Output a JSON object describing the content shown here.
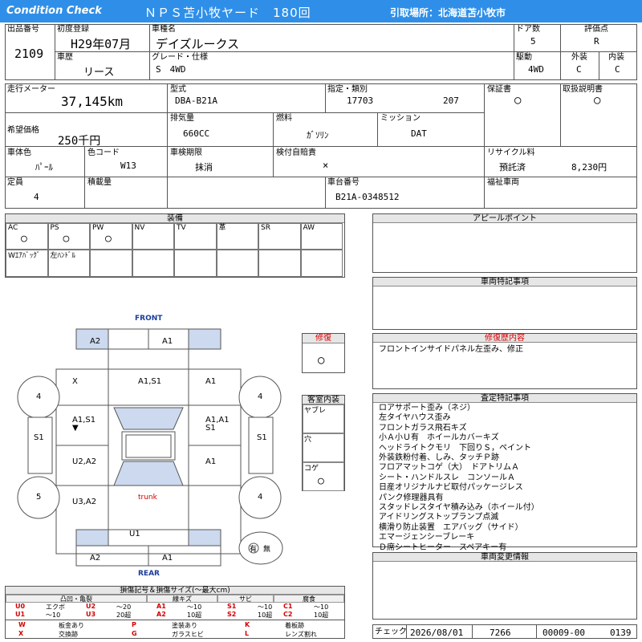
{
  "header": {
    "title_left": "Condition  Check",
    "title_center": "ＮＰＳ苫小牧ヤード　180回",
    "pickup": "引取場所：北海道苫小牧市"
  },
  "info": {
    "lot_label": "出品番号",
    "lot": "2109",
    "first_reg_label": "初度登録",
    "first_reg": "H29年07月",
    "car_name_label": "車種名",
    "car_name": "デイズルークス",
    "doors_label": "ドア数",
    "doors": "5",
    "grade_label": "評価点",
    "grade": "R",
    "history_label": "車歴",
    "history": "リース",
    "trim_label": "グレード・仕様",
    "trim": "S　4WD",
    "drive_label": "駆動",
    "drive": "4WD",
    "exterior_label": "外装",
    "exterior": "C",
    "interior_label": "内装",
    "interior": "C",
    "mileage_label": "走行メーター",
    "mileage": "37,145km",
    "model_label": "型式",
    "model": "DBA-B21A",
    "designation_label": "指定・類別",
    "designation": "17703",
    "classification": "207",
    "warranty_label": "保証書",
    "warranty": "○",
    "manual_label": "取扱説明書",
    "manual": "○",
    "desired_price_label": "希望価格",
    "desired_price": "250千円",
    "displacement_label": "排気量",
    "displacement": "660CC",
    "fuel_label": "燃料",
    "fuel": "ｶﾞｿﾘﾝ",
    "mission_label": "ミッション",
    "mission": "DAT",
    "color_label": "車体色",
    "color": "ﾊﾟｰﾙ",
    "color_code_label": "色コード",
    "color_code": "W13",
    "inspection_label": "車検期限",
    "inspection": "抹消",
    "insurance_label": "検付自賠責",
    "insurance": "×",
    "recycle_label": "リサイクル料",
    "recycle_status": "預託済",
    "recycle_amount": "8,230円",
    "capacity_label": "定員",
    "capacity": "4",
    "load_label": "積載量",
    "load": "",
    "chassis_label": "車台番号",
    "chassis": "B21A-0348512",
    "welfare_label": "福祉車両"
  },
  "equipment": {
    "title": "装備",
    "row1": [
      {
        "label": "AC",
        "mark": "○"
      },
      {
        "label": "PS",
        "mark": "○"
      },
      {
        "label": "PW",
        "mark": "○"
      },
      {
        "label": "NV",
        "mark": ""
      },
      {
        "label": "TV",
        "mark": ""
      },
      {
        "label": "革",
        "mark": ""
      },
      {
        "label": "SR",
        "mark": ""
      },
      {
        "label": "AW",
        "mark": ""
      }
    ],
    "row2": [
      {
        "label": "Wｴｱﾊﾞｯｸﾞ"
      },
      {
        "label": "左ﾊﾝﾄﾞﾙ"
      }
    ]
  },
  "panels": {
    "appeal_title": "アピールポイント",
    "special_title": "車両特記事項",
    "repair_title": "修復",
    "repair_mark": "○",
    "repair_detail_title": "修復歴内容",
    "repair_detail": "フロントインサイドパネル左歪み、修正",
    "cabin_title": "客室内装",
    "cabin_rows": [
      {
        "label": "ヤブレ",
        "mark": ""
      },
      {
        "label": "穴",
        "mark": ""
      },
      {
        "label": "コゲ",
        "mark": "○"
      }
    ],
    "inspection_title": "査定特記事項",
    "inspection_notes": [
      "ロアサポート歪み（ネジ）",
      "左タイヤハウス歪み",
      "フロントガラス飛石キズ",
      "小Ａ小Ｕ有　ホイールカバーキズ",
      "ヘッドライトクモリ　下回りＳ，ペイント",
      "外装鉄粉付着、しみ、タッチＰ跡",
      "フロアマットコゲ（大）　ドアトリムＡ",
      "シート・ハンドルスレ　コンソールＡ",
      "日産オリジナルナビ取付パッケージレス",
      "パンク修理器具有",
      "スタッドレスタイヤ積み込み（ホイール付）",
      "アイドリングストップランプ点滅",
      "横滑り防止装置　エアバッグ（サイド）",
      "エマージェンシーブレーキ",
      "Ｄ席シートヒーター　スペアキー有"
    ],
    "change_title": "車両変更情報"
  },
  "diagram": {
    "front": "FRONT",
    "rear": "REAR",
    "trunk": "trunk",
    "labels": {
      "top_left": "A2",
      "top_right": "A1",
      "x": "X",
      "hood": "A1,S1",
      "fr_fender": "A1",
      "fl_door": "A1,S1\n▼",
      "fr_door": "A1,A1\nS1",
      "rl_door": "U2,A2",
      "rr_door": "A1",
      "rl_quarter": "U3,A2",
      "rr_quarter": "4",
      "rear_bumper": "U1",
      "bottom_left": "A2",
      "bottom_right": "A1",
      "tire_fl": "4",
      "tire_fr": "4",
      "tire_rl": "5",
      "tire_rr": "4",
      "side_l": "S1",
      "side_r": "S1",
      "spare": "有",
      "spare_none": "無"
    }
  },
  "legend": {
    "title": "損傷記号＆損傷サイズ(〜最大cm)",
    "groups": [
      {
        "name": "凸凹・亀裂",
        "codes": [
          [
            "U0",
            "エクボ"
          ],
          [
            "U1",
            "〜10"
          ],
          [
            "U2",
            "〜20"
          ],
          [
            "U3",
            "20超"
          ]
        ]
      },
      {
        "name": "線キズ",
        "codes": [
          [
            "A1",
            "〜10"
          ],
          [
            "A2",
            "10超"
          ]
        ]
      },
      {
        "name": "サビ",
        "codes": [
          [
            "S1",
            "〜10"
          ],
          [
            "S2",
            "10超"
          ]
        ]
      },
      {
        "name": "腐食",
        "codes": [
          [
            "C1",
            "〜10"
          ],
          [
            "C2",
            "10超"
          ]
        ]
      }
    ],
    "marks": [
      [
        "W",
        "板金あり"
      ],
      [
        "P",
        "塗装あり"
      ],
      [
        "K",
        "着板跡"
      ],
      [
        "X",
        "交換跡"
      ],
      [
        "G",
        "ガラスヒビ"
      ],
      [
        "L",
        "レンズ割れ"
      ]
    ]
  },
  "footer": {
    "check_label": "チェック",
    "check_date": "2026/08/01",
    "check_code": "7266",
    "ref_number": "00009-00",
    "ref_suffix": "0139"
  }
}
